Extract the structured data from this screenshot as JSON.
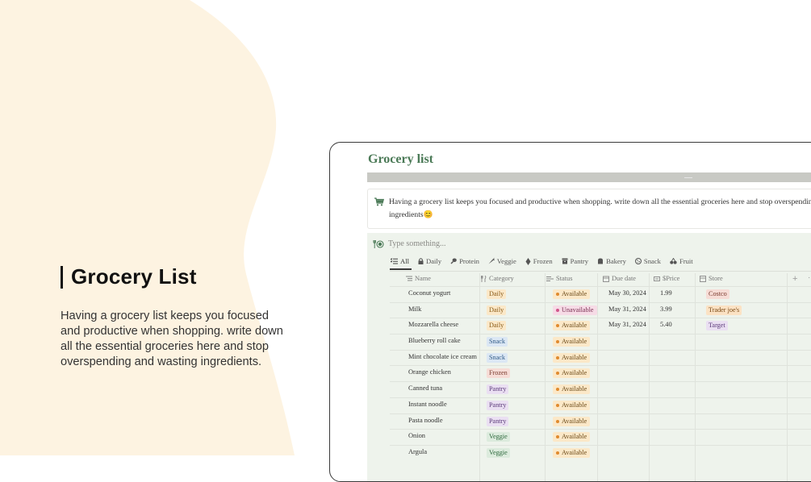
{
  "hero": {
    "title": "Grocery List",
    "description": "Having a grocery list keeps you focused and productive when shopping. write down all the essential groceries here and stop overspending and wasting ingredients."
  },
  "page": {
    "title": "Grocery list",
    "callout_text": "Having a grocery list keeps you focused and productive when shopping. write down all the essential groceries here and stop overspending and wasting ingredients😊"
  },
  "search": {
    "placeholder": "Type something..."
  },
  "tabs": [
    {
      "label": "All",
      "icon": "list-icon",
      "active": true
    },
    {
      "label": "Daily",
      "icon": "lock-icon"
    },
    {
      "label": "Protein",
      "icon": "drumstick-icon"
    },
    {
      "label": "Veggie",
      "icon": "carrot-icon"
    },
    {
      "label": "Frozen",
      "icon": "snowflake-icon"
    },
    {
      "label": "Pantry",
      "icon": "box-icon"
    },
    {
      "label": "Bakery",
      "icon": "bread-icon"
    },
    {
      "label": "Snack",
      "icon": "cookie-icon"
    },
    {
      "label": "Fruit",
      "icon": "fruit-icon"
    }
  ],
  "columns": {
    "name": "Name",
    "category": "Category",
    "status": "Status",
    "due_date": "Due date",
    "price": "$Price",
    "store": "Store"
  },
  "colors": {
    "accent": "#4b7a57",
    "blob": "#fdf3e1",
    "db_background": "#eef3ec",
    "daily_tag": "#fbe8c8",
    "snack_tag": "#dbe7f4",
    "frozen_tag": "#f6dcd6",
    "pantry_tag": "#eadff2",
    "veggie_tag": "#dcebdd",
    "available_dot": "#e08a2e",
    "unavailable_dot": "#d1558b"
  },
  "rows": [
    {
      "name": "Coconut yogurt",
      "category": "Daily",
      "status": "Available",
      "due_date": "May 30, 2024",
      "price": "1.99",
      "store": "Costco"
    },
    {
      "name": "Milk",
      "category": "Daily",
      "status": "Unavailable",
      "due_date": "May 31, 2024",
      "price": "3.99",
      "store": "Trader joe's"
    },
    {
      "name": "Mozzarella cheese",
      "category": "Daily",
      "status": "Available",
      "due_date": "May 31, 2024",
      "price": "5.40",
      "store": "Target"
    },
    {
      "name": "Blueberry roll cake",
      "category": "Snack",
      "status": "Available",
      "due_date": "",
      "price": "",
      "store": ""
    },
    {
      "name": "Mint chocolate ice cream",
      "category": "Snack",
      "status": "Available",
      "due_date": "",
      "price": "",
      "store": ""
    },
    {
      "name": "Orange chicken",
      "category": "Frozen",
      "status": "Available",
      "due_date": "",
      "price": "",
      "store": ""
    },
    {
      "name": "Canned tuna",
      "category": "Pantry",
      "status": "Available",
      "due_date": "",
      "price": "",
      "store": ""
    },
    {
      "name": "Instant noodle",
      "category": "Pantry",
      "status": "Available",
      "due_date": "",
      "price": "",
      "store": ""
    },
    {
      "name": "Pasta noodle",
      "category": "Pantry",
      "status": "Available",
      "due_date": "",
      "price": "",
      "store": ""
    },
    {
      "name": "Onion",
      "category": "Veggie",
      "status": "Available",
      "due_date": "",
      "price": "",
      "store": ""
    },
    {
      "name": "Argula",
      "category": "Veggie",
      "status": "Available",
      "due_date": "",
      "price": "",
      "store": ""
    }
  ]
}
